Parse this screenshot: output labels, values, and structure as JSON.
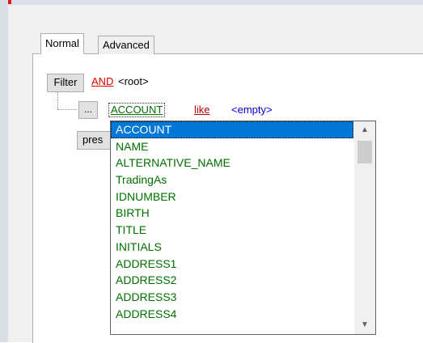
{
  "tabs": [
    {
      "label": "Normal",
      "active": true
    },
    {
      "label": "Advanced",
      "active": false
    }
  ],
  "filter": {
    "button_label": "Filter",
    "operator": "AND",
    "root_label": "<root>"
  },
  "condition": {
    "menu_button_label": "...",
    "field": "ACCOUNT",
    "comparison": "like",
    "value": "<empty>"
  },
  "preset_button_label": "pres",
  "dropdown": {
    "selected": "ACCOUNT",
    "items": [
      "ACCOUNT",
      "NAME",
      "ALTERNATIVE_NAME",
      "TradingAs",
      "IDNUMBER",
      "BIRTH",
      "TITLE",
      "INITIALS",
      "ADDRESS1",
      "ADDRESS2",
      "ADDRESS3",
      "ADDRESS4"
    ]
  },
  "icons": {
    "scroll_up": "chevron-up-icon",
    "scroll_down": "chevron-down-icon"
  },
  "colors": {
    "operator": "#e00000",
    "field": "#007000",
    "comparison": "#b00000",
    "value": "#0000dd",
    "selection": "#0078d7"
  }
}
